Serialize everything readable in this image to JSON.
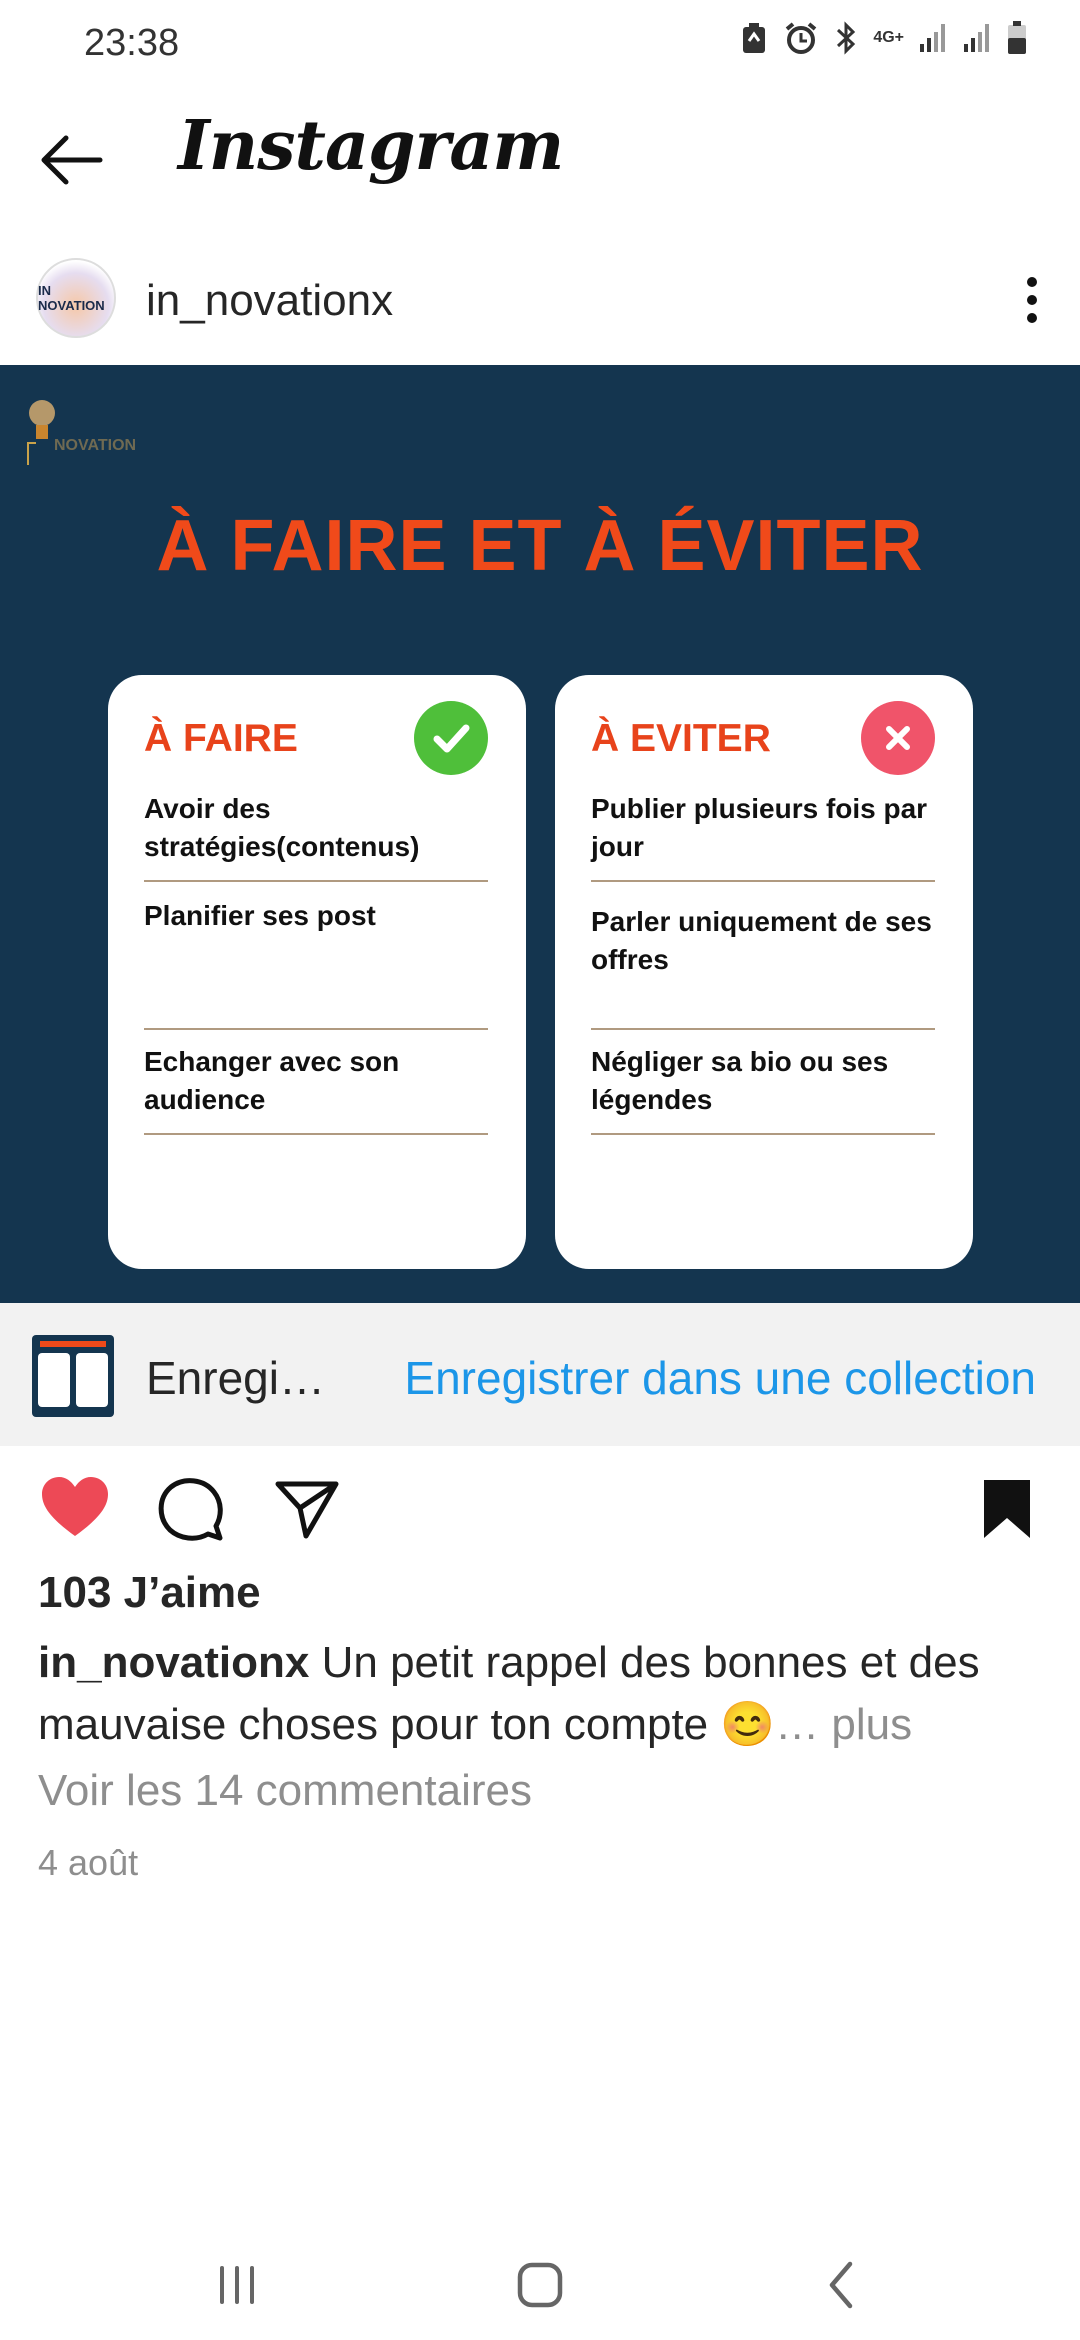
{
  "status_bar": {
    "time": "23:38",
    "network": "4G+"
  },
  "header": {
    "title": "Instagram"
  },
  "post": {
    "username": "in_novationx",
    "avatar_text": "IN NOVATION",
    "image": {
      "logo_text": "NOVATION",
      "title": "À FAIRE ET À ÉVITER",
      "do_card": {
        "heading": "À FAIRE",
        "items": [
          "Avoir des stratégies(contenus)",
          "Planifier ses post",
          "Echanger avec son audience"
        ]
      },
      "avoid_card": {
        "heading": "À EVITER",
        "items": [
          "Publier plusieurs fois par jour",
          "Parler uniquement de ses offres",
          "Négliger sa bio ou ses légendes"
        ]
      }
    },
    "save_bar": {
      "label": "Enregi…",
      "link": "Enregistrer dans une collection"
    },
    "likes": "103 J’aime",
    "caption": {
      "user": "in_novationx",
      "text": " Un petit rappel des bonnes et des mauvaise choses pour ton compte 😊",
      "more": "… plus"
    },
    "comments": "Voir les 14 commentaires",
    "date": "4 août"
  },
  "colors": {
    "accent_red": "#f04a1a",
    "like_red": "#ed4956",
    "link_blue": "#1c96e8",
    "navy": "#14354f"
  }
}
